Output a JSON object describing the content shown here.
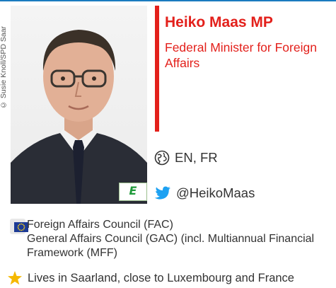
{
  "photo_credit": "© Susie Knoll/SPD Saar",
  "profile": {
    "name": "Heiko Maas MP",
    "role": "Federal Minister for Foreign Affairs"
  },
  "badge": {
    "label": "E"
  },
  "languages": {
    "icon": "globe-icon",
    "text": "EN, FR"
  },
  "twitter": {
    "icon": "twitter-bird-icon",
    "handle": "@HeikoMaas"
  },
  "committees": {
    "icon": "eu-flag-icon",
    "items": [
      "Foreign Affairs Council (FAC)",
      "General Affairs Council (GAC) (incl. Multiannual Financial Framework (MFF)"
    ]
  },
  "residence": {
    "icon": "star-icon",
    "text": "Lives in Saarland, close to Luxembourg and France"
  },
  "colors": {
    "accent_red": "#e3201b",
    "rule_blue": "#1a7bbf",
    "twitter_blue": "#1da1f2",
    "star_yellow": "#f5b800",
    "eu_blue": "#1d3b95"
  }
}
